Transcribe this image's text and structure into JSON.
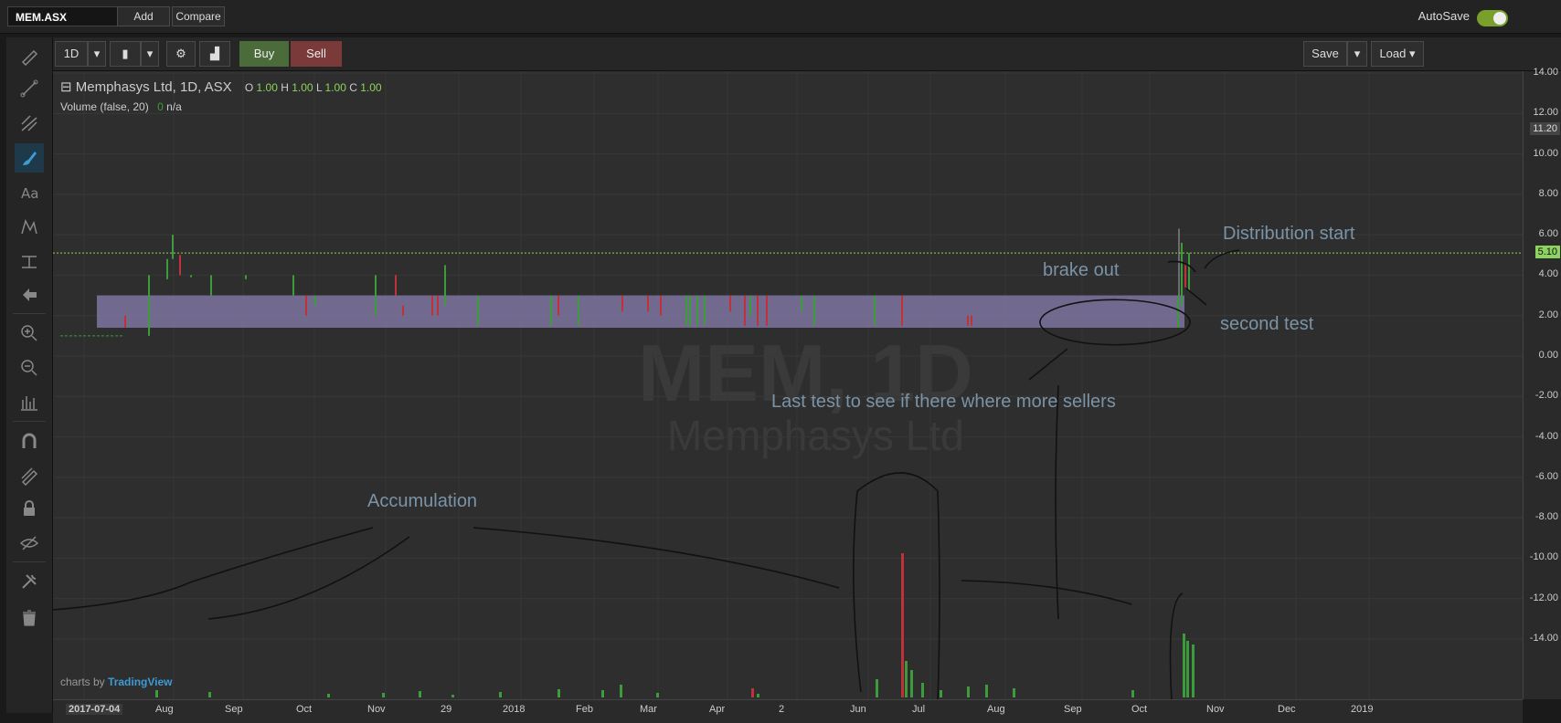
{
  "topbar": {
    "symbol": "MEM.ASX",
    "add": "Add",
    "compare": "Compare",
    "autosave": "AutoSave"
  },
  "chartbar": {
    "interval": "1D",
    "buy": "Buy",
    "sell": "Sell",
    "save": "Save",
    "load": "Load"
  },
  "legend": {
    "title": "Memphasys Ltd, 1D, ASX",
    "o_label": "O",
    "o": "1.00",
    "h_label": "H",
    "h": "1.00",
    "l_label": "L",
    "l": "1.00",
    "c_label": "C",
    "c": "1.00",
    "volume": "Volume (false, 20)",
    "vol_value": "0",
    "vol_na": "n/a"
  },
  "watermark": {
    "main": "MEM, 1D",
    "sub": "Memphasys Ltd"
  },
  "annotations": {
    "distribution": "Distribution start",
    "brakeout": "brake out",
    "second_test": "second test",
    "last_test": "Last test to see if there where more sellers",
    "accumulation": "Accumulation"
  },
  "credit": {
    "prefix": "charts by",
    "brand": "TradingView"
  },
  "y_axis": [
    "14.00",
    "12.00",
    "10.00",
    "8.00",
    "6.00",
    "4.00",
    "2.00",
    "0.00",
    "-2.00",
    "-4.00",
    "-6.00",
    "-8.00",
    "-10.00",
    "-12.00",
    "-14.00"
  ],
  "price_badges": {
    "high": "11.20",
    "current": "5.10"
  },
  "x_axis": [
    "2017-07-04",
    "Aug",
    "Sep",
    "Oct",
    "Nov",
    "29",
    "2018",
    "Feb",
    "Mar",
    "Apr",
    "2",
    "Jun",
    "Jul",
    "Aug",
    "Sep",
    "Oct",
    "Nov",
    "Dec",
    "2019"
  ],
  "colors": {
    "up": "#3c9c3c",
    "down": "#c0323a",
    "zone": "#8a7db0",
    "accent": "#3d9bd6",
    "guide": "#8dd35f"
  },
  "icons": [
    "pencil-icon",
    "trendline-icon",
    "pitchfork-icon",
    "brush-icon",
    "text-icon",
    "pattern-icon",
    "measure-icon",
    "arrow-icon",
    "zoom-in-icon",
    "zoom-out-icon",
    "bars-icon",
    "magnet-icon",
    "lock-drawings-icon",
    "lock-icon",
    "hide-icon",
    "settings-icon",
    "trash-icon"
  ]
}
